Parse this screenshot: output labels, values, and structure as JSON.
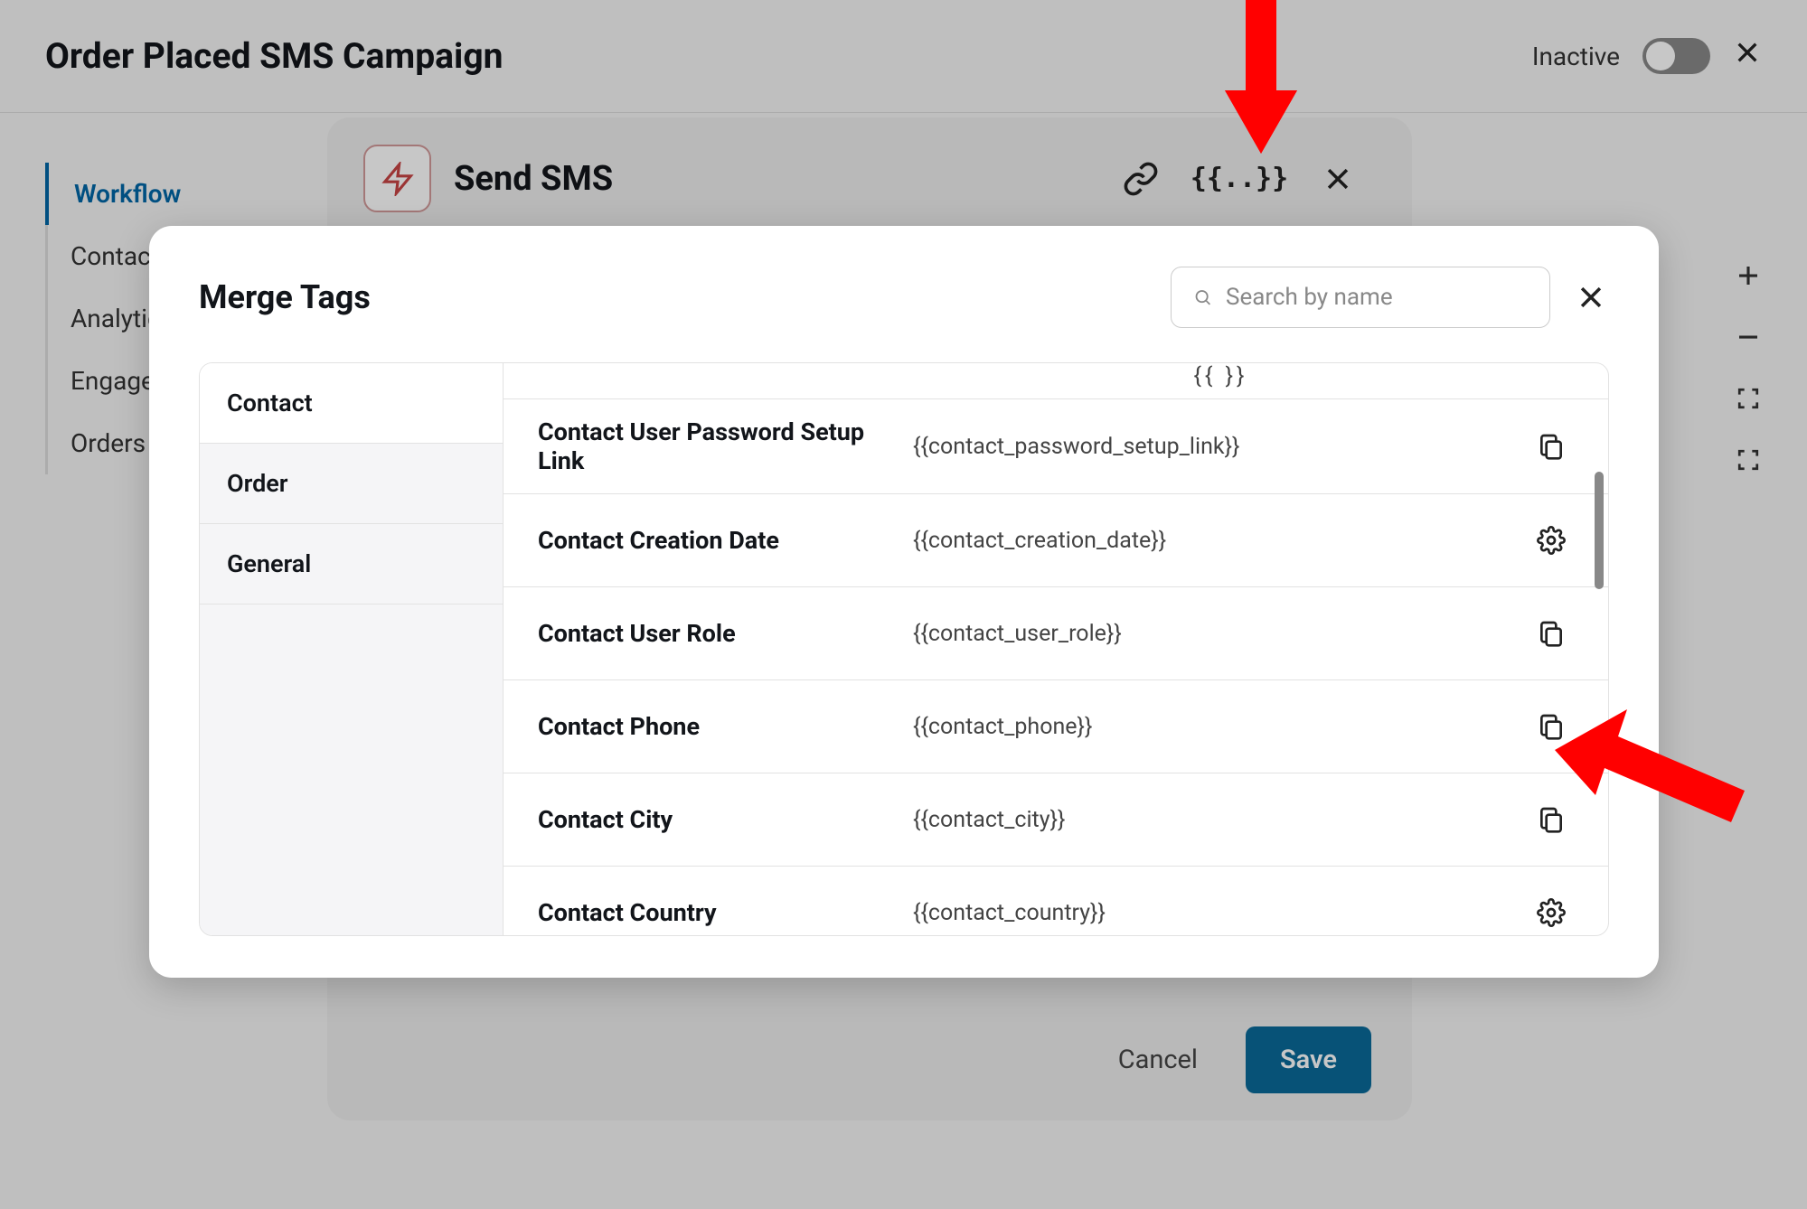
{
  "header": {
    "title": "Order Placed SMS Campaign",
    "status_label": "Inactive"
  },
  "sidebar": {
    "items": [
      {
        "label": "Workflow",
        "active": true
      },
      {
        "label": "Contacts",
        "active": false
      },
      {
        "label": "Analytics",
        "active": false
      },
      {
        "label": "Engagement",
        "active": false
      },
      {
        "label": "Orders",
        "active": false
      }
    ]
  },
  "send_sms_panel": {
    "title": "Send SMS",
    "cancel_label": "Cancel",
    "save_label": "Save"
  },
  "modal": {
    "title": "Merge Tags",
    "search_placeholder": "Search by name",
    "categories": [
      {
        "label": "Contact",
        "active": true
      },
      {
        "label": "Order",
        "active": false
      },
      {
        "label": "General",
        "active": false
      }
    ],
    "tags": [
      {
        "label": "Contact User Password Setup Link",
        "value": "{{contact_password_setup_link}}",
        "action": "copy"
      },
      {
        "label": "Contact Creation Date",
        "value": "{{contact_creation_date}}",
        "action": "settings"
      },
      {
        "label": "Contact User Role",
        "value": "{{contact_user_role}}",
        "action": "copy"
      },
      {
        "label": "Contact Phone",
        "value": "{{contact_phone}}",
        "action": "copy"
      },
      {
        "label": "Contact City",
        "value": "{{contact_city}}",
        "action": "copy"
      },
      {
        "label": "Contact Country",
        "value": "{{contact_country}}",
        "action": "settings"
      }
    ]
  }
}
